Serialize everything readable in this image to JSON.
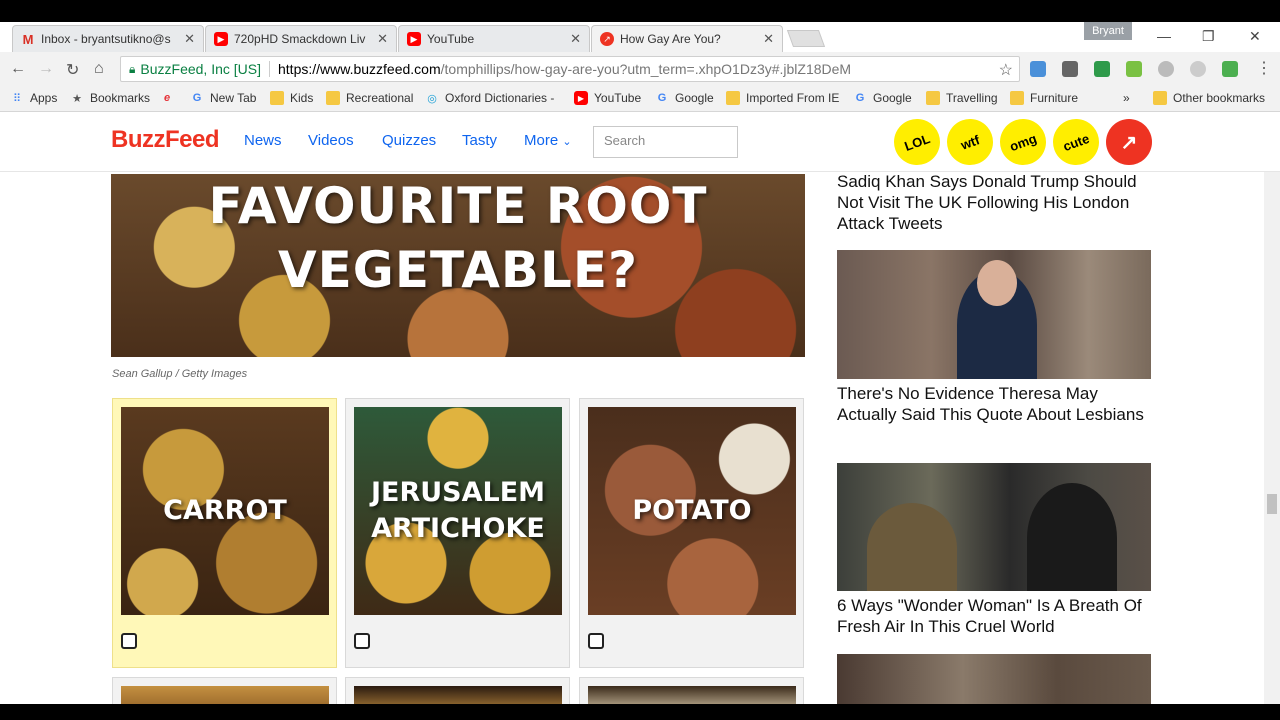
{
  "tabs": [
    {
      "title": "Inbox - bryantsutikno@s",
      "icon": "gmail-icon",
      "color": "#d93025"
    },
    {
      "title": "720pHD Smackdown Liv",
      "icon": "youtube-icon",
      "color": "#ff0000"
    },
    {
      "title": "YouTube",
      "icon": "youtube-icon",
      "color": "#ff0000"
    },
    {
      "title": "How Gay Are You?",
      "icon": "buzzfeed-icon",
      "color": "#ee3322"
    }
  ],
  "profile_name": "Bryant",
  "address": {
    "secure_label": "BuzzFeed, Inc [US]",
    "url_host": "https://www.buzzfeed.com",
    "url_path": "/tomphillips/how-gay-are-you?utm_term=.xhpO1Dz3y#.jblZ18DeM"
  },
  "bookmarks": [
    {
      "label": "Apps",
      "icon": "apps-icon"
    },
    {
      "label": "Bookmarks",
      "icon": "star-icon"
    },
    {
      "label": "",
      "icon": "ebay-icon"
    },
    {
      "label": "New Tab",
      "icon": "google-icon"
    },
    {
      "label": "Kids",
      "icon": "folder-icon"
    },
    {
      "label": "Recreational",
      "icon": "folder-icon"
    },
    {
      "label": "Oxford Dictionaries -",
      "icon": "oxford-icon"
    },
    {
      "label": "YouTube",
      "icon": "youtube-icon"
    },
    {
      "label": "Google",
      "icon": "google-icon"
    },
    {
      "label": "Imported From IE",
      "icon": "folder-icon"
    },
    {
      "label": "Google",
      "icon": "google-icon"
    },
    {
      "label": "Travelling",
      "icon": "folder-icon"
    },
    {
      "label": "Furniture",
      "icon": "folder-icon"
    }
  ],
  "bookmarks_overflow": "»",
  "other_bookmarks": "Other bookmarks",
  "site": {
    "logo": "BuzzFeed",
    "nav": [
      "News",
      "Videos",
      "Quizzes",
      "Tasty"
    ],
    "more": "More",
    "search_placeholder": "Search",
    "badges": [
      "LOL",
      "wtf",
      "omg",
      "cute"
    ],
    "accent": "#ee3322",
    "link_color": "#0f65ef"
  },
  "question": {
    "title_line1": "FAVOURITE ROOT",
    "title_line2": "VEGETABLE?",
    "credit": "Sean Gallup / Getty Images",
    "answers": [
      {
        "label": "CARROT",
        "selected": true
      },
      {
        "label": "JERUSALEM ARTICHOKE",
        "selected": false
      },
      {
        "label": "POTATO",
        "selected": false
      }
    ]
  },
  "sidebar": [
    {
      "title": "Sadiq Khan Says Donald Trump Should Not Visit The UK Following His London Attack Tweets"
    },
    {
      "title": "There's No Evidence Theresa May Actually Said This Quote About Lesbians"
    },
    {
      "title": "6 Ways \"Wonder Woman\" Is A Breath Of Fresh Air In This Cruel World"
    }
  ]
}
